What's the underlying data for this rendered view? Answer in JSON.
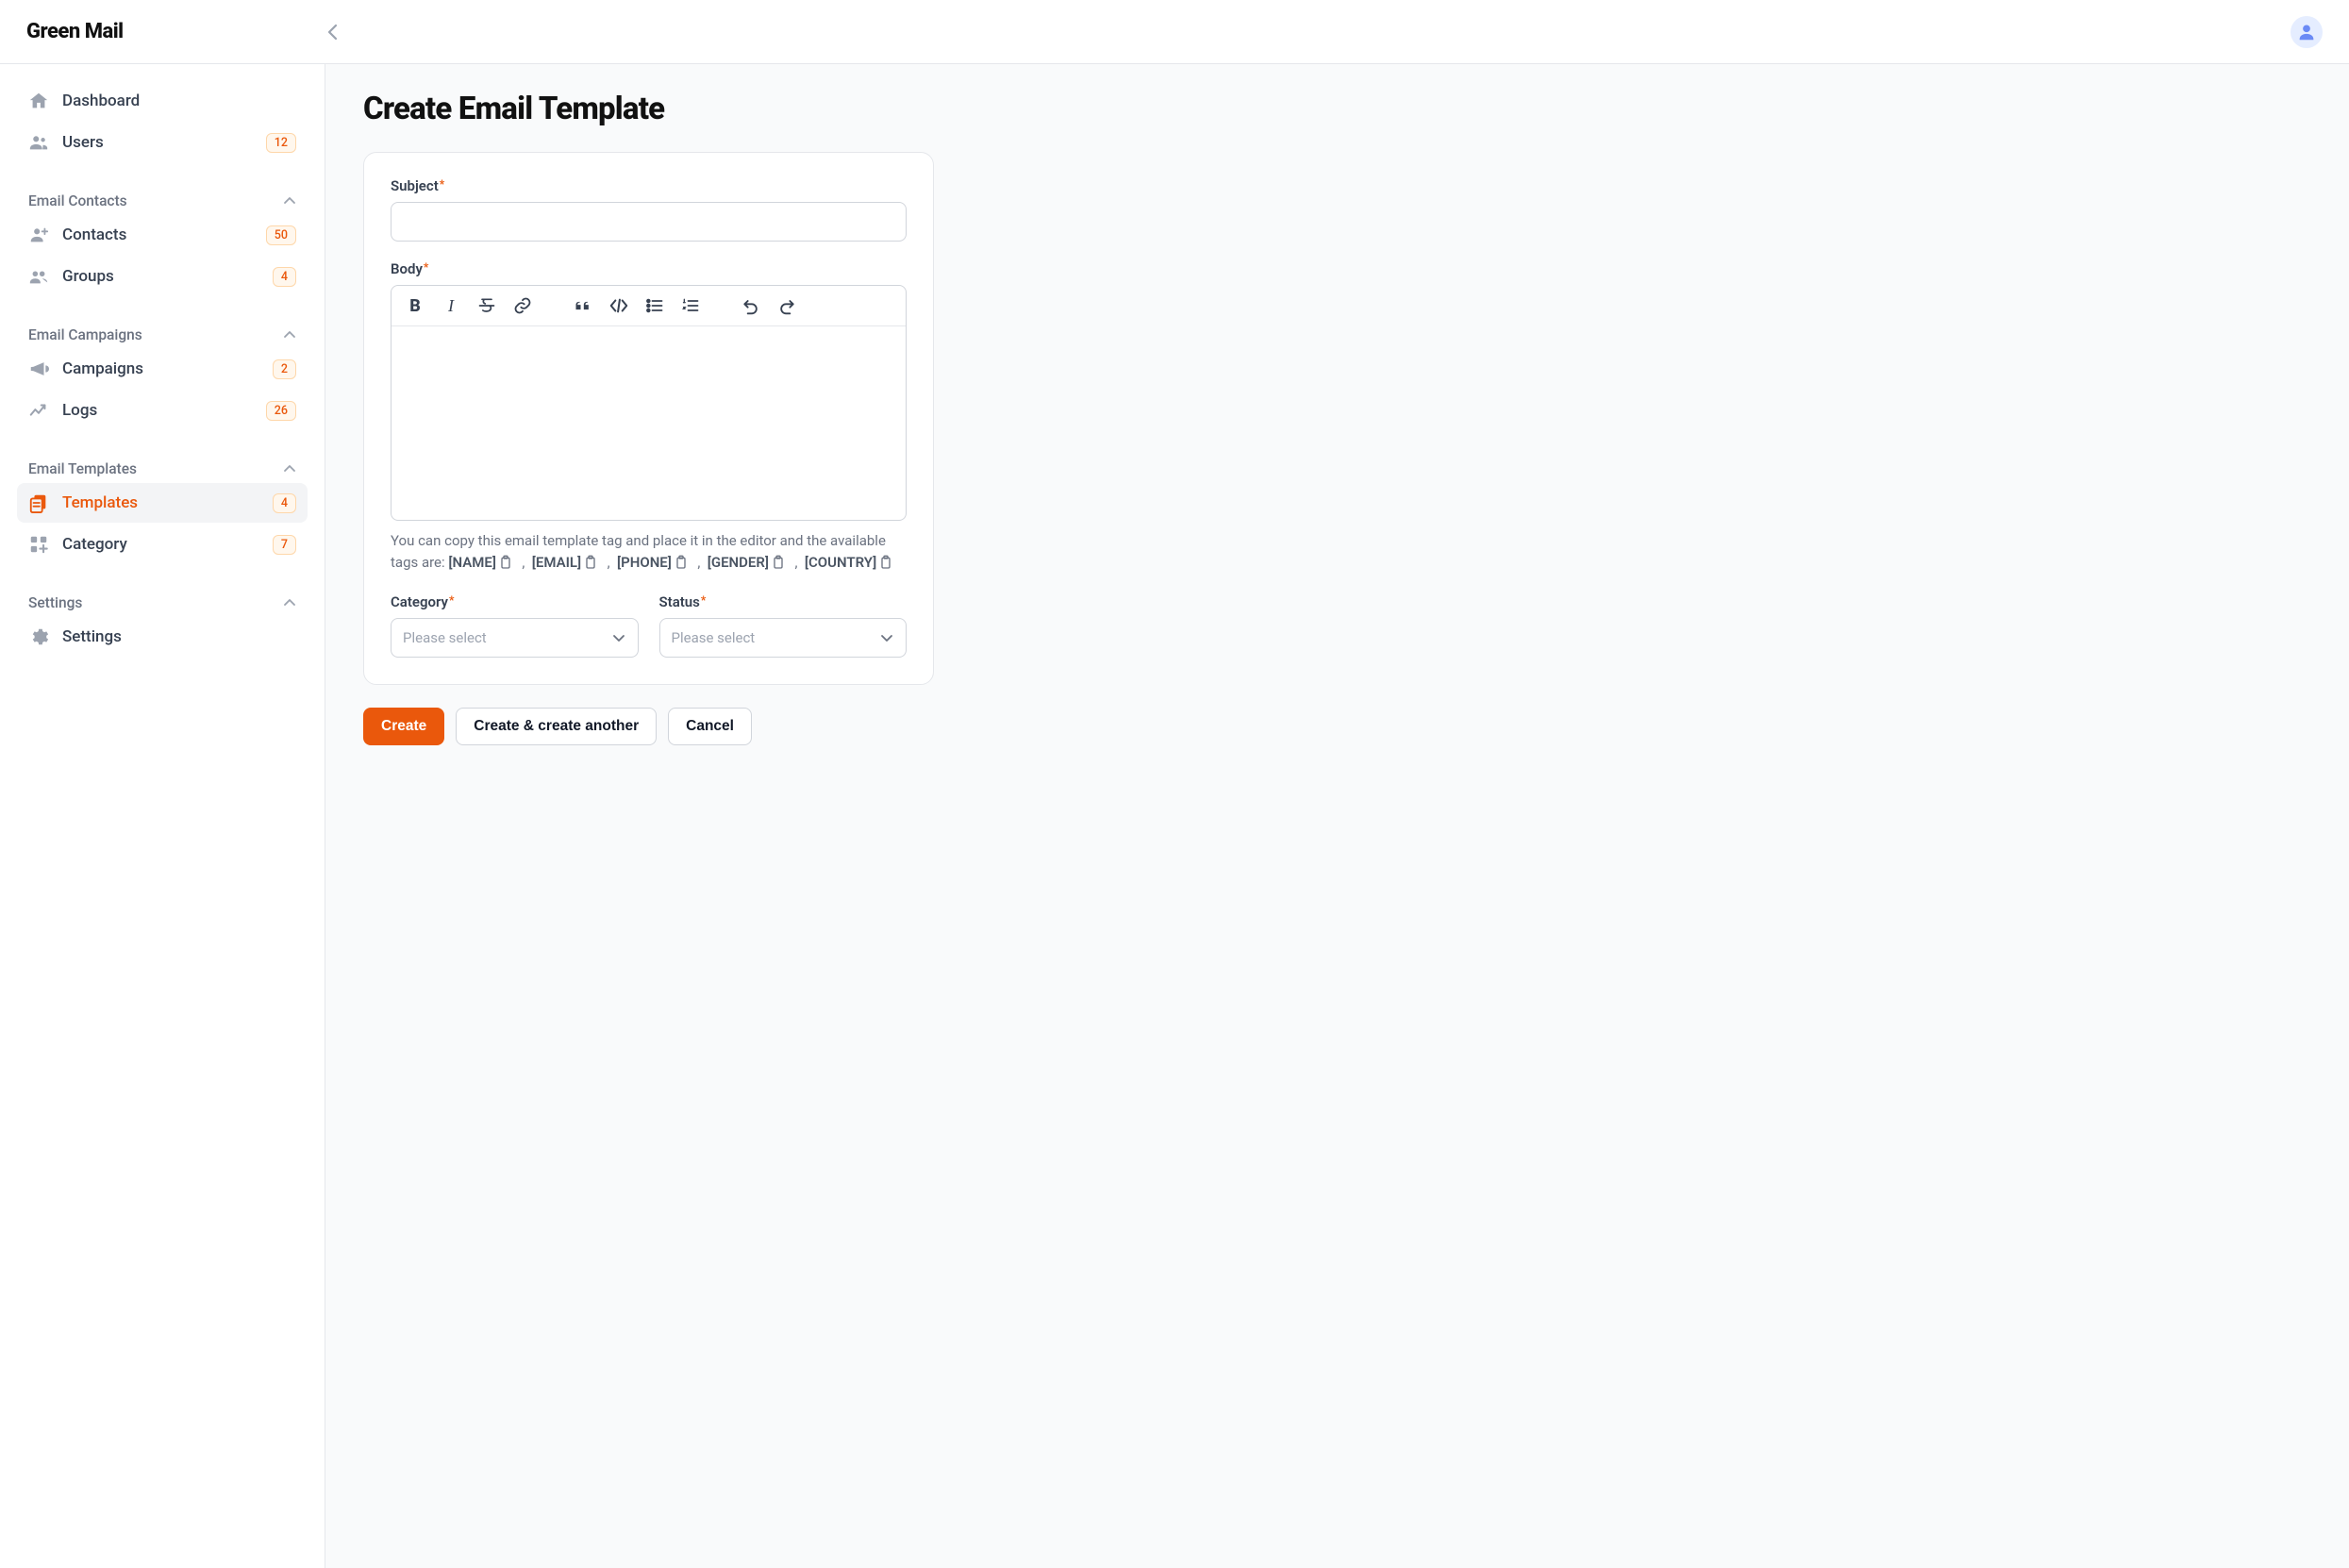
{
  "brand": "Green Mail",
  "sidebar": {
    "top": [
      {
        "label": "Dashboard",
        "icon": "home",
        "badge": null
      },
      {
        "label": "Users",
        "icon": "users",
        "badge": "12"
      }
    ],
    "groups": [
      {
        "title": "Email Contacts",
        "items": [
          {
            "label": "Contacts",
            "icon": "person-plus",
            "badge": "50"
          },
          {
            "label": "Groups",
            "icon": "people",
            "badge": "4"
          }
        ]
      },
      {
        "title": "Email Campaigns",
        "items": [
          {
            "label": "Campaigns",
            "icon": "megaphone",
            "badge": "2"
          },
          {
            "label": "Logs",
            "icon": "trend",
            "badge": "26"
          }
        ]
      },
      {
        "title": "Email Templates",
        "items": [
          {
            "label": "Templates",
            "icon": "template",
            "badge": "4",
            "active": true
          },
          {
            "label": "Category",
            "icon": "squares",
            "badge": "7"
          }
        ]
      },
      {
        "title": "Settings",
        "items": [
          {
            "label": "Settings",
            "icon": "gear",
            "badge": null
          }
        ]
      }
    ]
  },
  "page": {
    "title": "Create Email Template",
    "subject_label": "Subject",
    "subject_value": "",
    "body_label": "Body",
    "hint_prefix": "You can copy this email template tag and place it in the editor and the available tags are: ",
    "tags": [
      "[NAME]",
      "[EMAIL]",
      "[PHONE]",
      "[GENDER]",
      "[COUNTRY]"
    ],
    "category_label": "Category",
    "category_placeholder": "Please select",
    "status_label": "Status",
    "status_placeholder": "Please select",
    "buttons": {
      "create": "Create",
      "create_another": "Create & create another",
      "cancel": "Cancel"
    }
  }
}
